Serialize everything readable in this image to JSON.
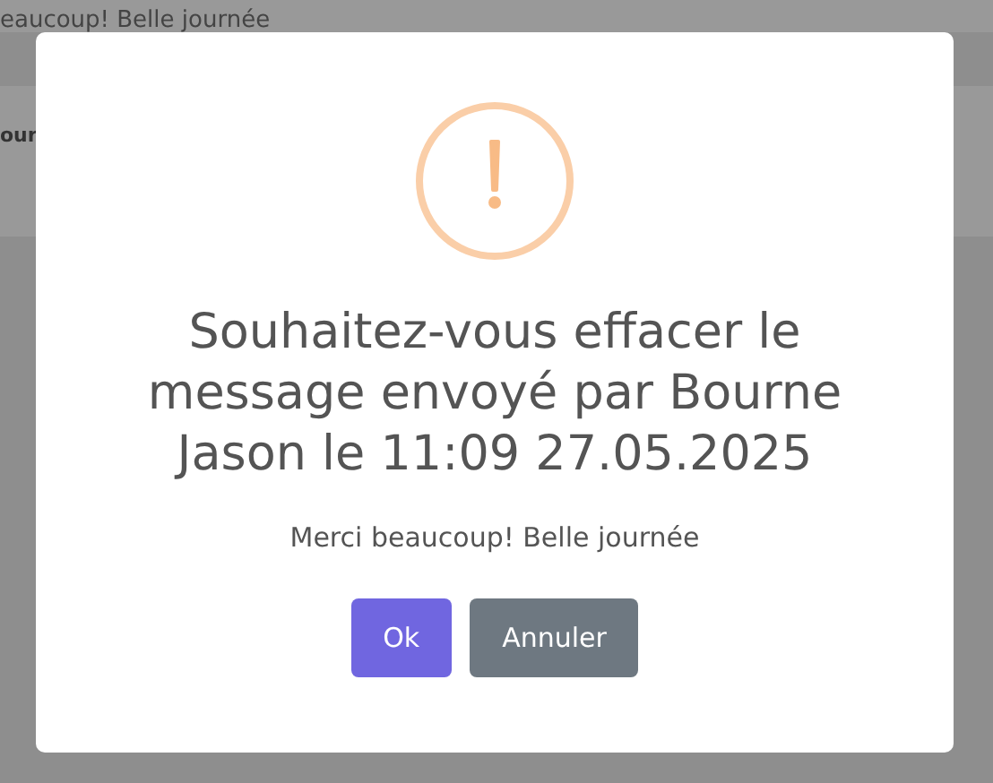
{
  "background": {
    "message_fragment": "eaucoup! Belle journée",
    "sender_fragment": "our"
  },
  "dialog": {
    "title": "Souhaitez-vous effacer le message envoyé par Bourne Jason le 11:09 27.05.2025",
    "text": "Merci beaucoup! Belle journée",
    "buttons": [
      {
        "label": "Ok",
        "kind": "confirm"
      },
      {
        "label": "Annuler",
        "kind": "cancel"
      }
    ]
  }
}
